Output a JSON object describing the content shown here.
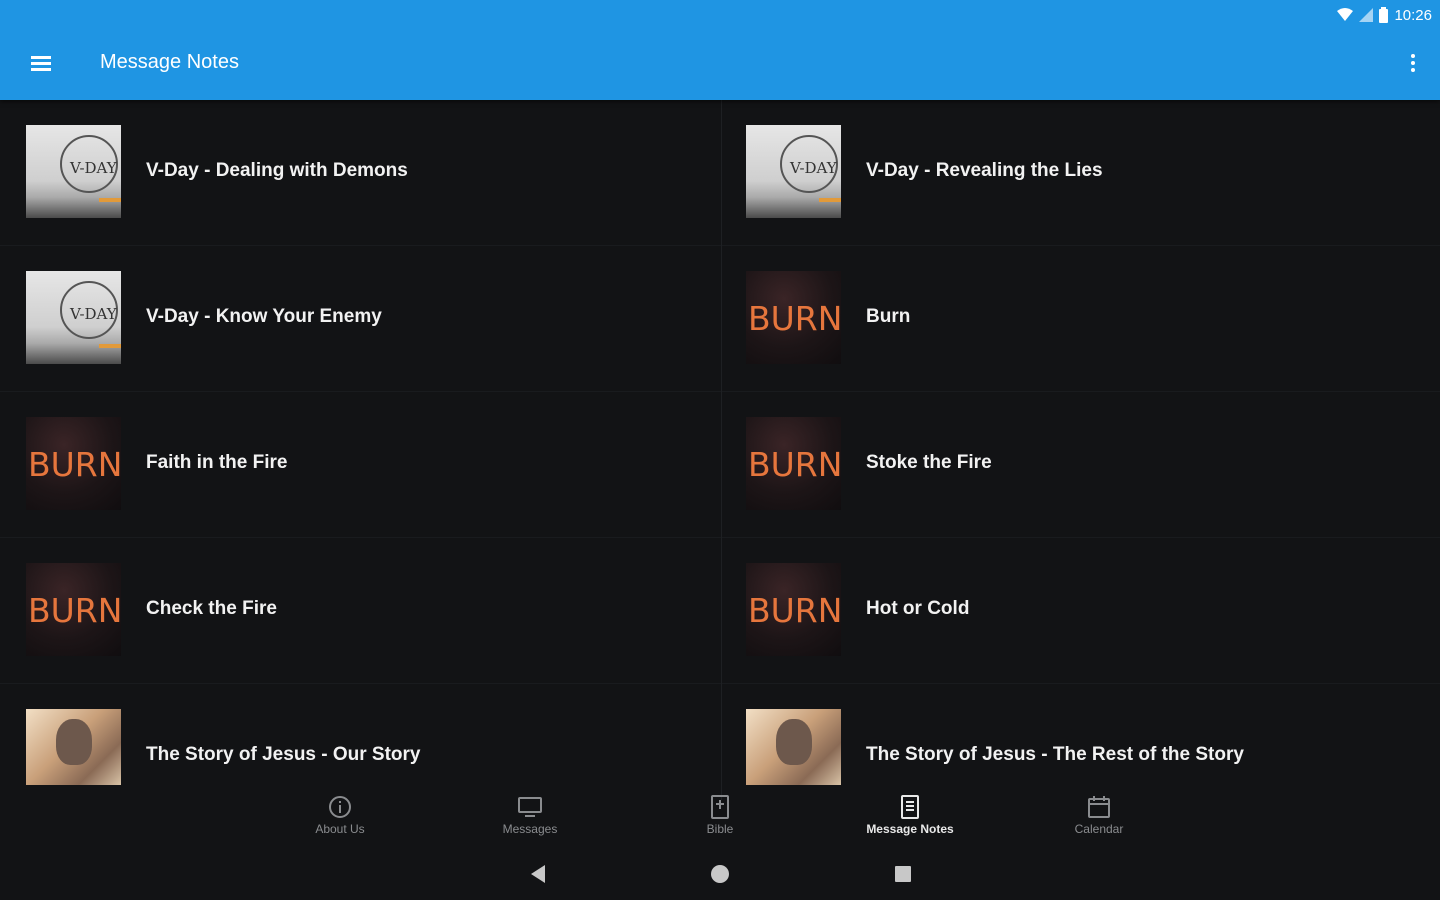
{
  "status_bar": {
    "time": "10:26"
  },
  "app_bar": {
    "title": "Message Notes"
  },
  "notes": [
    {
      "title": "V-Day - Dealing with Demons",
      "thumb": "vday",
      "thumb_text": "V-DAY"
    },
    {
      "title": "V-Day - Revealing the Lies",
      "thumb": "vday",
      "thumb_text": "V-DAY"
    },
    {
      "title": "V-Day - Know Your Enemy",
      "thumb": "vday",
      "thumb_text": "V-DAY"
    },
    {
      "title": "Burn",
      "thumb": "burn",
      "thumb_text": "BURN"
    },
    {
      "title": "Faith in the Fire",
      "thumb": "burn",
      "thumb_text": "BURN"
    },
    {
      "title": "Stoke the Fire",
      "thumb": "burn",
      "thumb_text": "BURN"
    },
    {
      "title": "Check the Fire",
      "thumb": "burn",
      "thumb_text": "BURN"
    },
    {
      "title": "Hot or Cold",
      "thumb": "burn",
      "thumb_text": "BURN"
    },
    {
      "title": "The Story of Jesus - Our Story",
      "thumb": "story"
    },
    {
      "title": "The Story of Jesus - The Rest of the Story",
      "thumb": "story"
    }
  ],
  "bottom_nav": [
    {
      "label": "About Us",
      "icon": "info-icon"
    },
    {
      "label": "Messages",
      "icon": "monitor-icon"
    },
    {
      "label": "Bible",
      "icon": "book-plus-icon"
    },
    {
      "label": "Message Notes",
      "icon": "notes-icon",
      "active": true
    },
    {
      "label": "Calendar",
      "icon": "calendar-icon"
    }
  ],
  "colors": {
    "app_bar": "#1f95e3",
    "background": "#121315",
    "burn_text": "#e6763d"
  }
}
